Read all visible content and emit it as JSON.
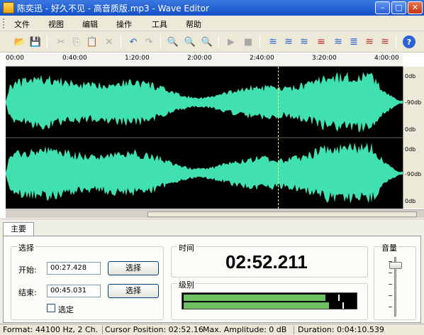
{
  "window": {
    "title": "陈奕迅 - 好久不见 - 高音质版.mp3 - Wave Editor",
    "controls": {
      "minimize": "–",
      "maximize": "□",
      "close": "✕"
    }
  },
  "menu": {
    "items": [
      "文件",
      "视图",
      "编辑",
      "操作",
      "工具",
      "帮助"
    ]
  },
  "toolbar": {
    "buttons": [
      {
        "icon": "open-folder-icon",
        "glyph": "📂"
      },
      {
        "icon": "save-icon",
        "glyph": "💾"
      },
      {
        "icon": "cut-icon",
        "glyph": "✂"
      },
      {
        "icon": "copy-icon",
        "glyph": "⎘"
      },
      {
        "icon": "paste-icon",
        "glyph": "📋"
      },
      {
        "icon": "delete-icon",
        "glyph": "✕"
      },
      {
        "icon": "undo-icon",
        "glyph": "↶"
      },
      {
        "icon": "redo-icon",
        "glyph": "↷"
      },
      {
        "icon": "zoom-in-icon",
        "glyph": "🔍"
      },
      {
        "icon": "zoom-out-icon",
        "glyph": "🔍"
      },
      {
        "icon": "zoom-fit-icon",
        "glyph": "🔍"
      },
      {
        "icon": "play-icon",
        "glyph": "▶"
      },
      {
        "icon": "stop-icon",
        "glyph": "■"
      },
      {
        "icon": "fade-in-icon",
        "glyph": "≋"
      },
      {
        "icon": "fade-out-icon",
        "glyph": "≋"
      },
      {
        "icon": "normalize-icon",
        "glyph": "≋"
      },
      {
        "icon": "silence-icon",
        "glyph": "≡"
      },
      {
        "icon": "amplify-icon",
        "glyph": "≋"
      },
      {
        "icon": "compress-icon",
        "glyph": "≣"
      },
      {
        "icon": "reverse-icon",
        "glyph": "≋"
      },
      {
        "icon": "effects-icon",
        "glyph": "≋"
      },
      {
        "icon": "help-icon",
        "glyph": "?"
      }
    ]
  },
  "timeline": {
    "labels": [
      "00:00",
      "0:40:00",
      "1:20:00",
      "2:00:00",
      "2:40:00",
      "3:20:00",
      "4:00:00"
    ]
  },
  "waveform": {
    "color": "#40e0b0",
    "channels": [
      {
        "db_top": "0db",
        "db_mid": "-90db",
        "db_bottom": "0db"
      },
      {
        "db_top": "0db",
        "db_mid": "-90db",
        "db_bottom": "0db"
      }
    ]
  },
  "panel": {
    "tab_label": "主要",
    "selection": {
      "title": "选择",
      "start_label": "开始:",
      "start_value": "00:27.428",
      "end_label": "结束:",
      "end_value": "00:45.031",
      "select_button": "选择",
      "checkbox_label": "选定"
    },
    "time": {
      "title": "时间",
      "value": "02:52.211"
    },
    "level": {
      "title": "级别",
      "channel1_level": 0.82,
      "channel2_level": 0.84
    },
    "volume": {
      "title": "音量",
      "level": 0.9
    }
  },
  "status": {
    "format": "Format: 44100 Hz, 2 Ch.",
    "cursor": "Cursor Position: 02:52.16",
    "amplitude": "Max. Amplitude: 0 dB",
    "duration": "Duration: 0:04:10.539"
  }
}
